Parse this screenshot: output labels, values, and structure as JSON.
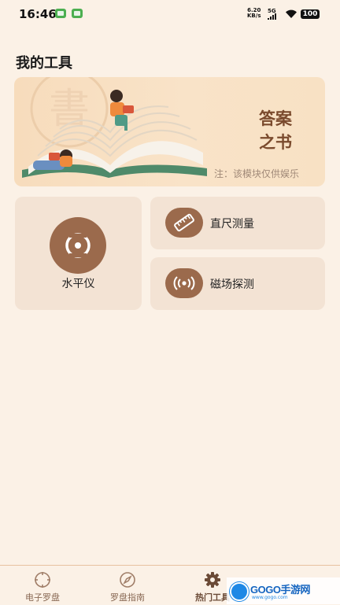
{
  "status_bar": {
    "time": "16:46",
    "net_speed_value": "6.20",
    "net_speed_unit": "KB/s",
    "network": "5G",
    "battery": "100"
  },
  "section_title": "我的工具",
  "banner": {
    "title_line1": "答案",
    "title_line2": "之书",
    "note": "注：该模块仅供娱乐",
    "background_glyph": "書"
  },
  "tools": {
    "level_label": "水平仪",
    "ruler_label": "直尺测量",
    "magnetic_label": "磁场探测"
  },
  "tabs": [
    {
      "label": "电子罗盘",
      "icon": "compass-target-icon"
    },
    {
      "label": "罗盘指南",
      "icon": "compass-needle-icon"
    },
    {
      "label": "热门工具",
      "icon": "gear-icon"
    }
  ],
  "active_tab": 2,
  "watermark": {
    "brand": "GOGO手游网",
    "sub": "www.gogo.com"
  },
  "colors": {
    "background": "#fbf1e6",
    "card": "#f3e3d4",
    "accent_brown": "#9b6a4c",
    "banner_title": "#7a4a2d"
  }
}
